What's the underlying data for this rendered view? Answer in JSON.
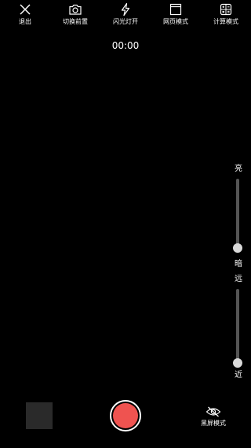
{
  "toolbar": {
    "exit": {
      "label": "退出",
      "icon": "close-icon"
    },
    "switch_camera": {
      "label": "切换前置",
      "icon": "camera-switch-icon"
    },
    "flash": {
      "label": "闪光灯开",
      "icon": "flash-icon"
    },
    "web_mode": {
      "label": "网页模式",
      "icon": "browser-window-icon"
    },
    "calc_mode": {
      "label": "计算模式",
      "icon": "calculator-icon"
    }
  },
  "timer": "00:00",
  "brightness": {
    "top_label": "亮",
    "bottom_label": "暗",
    "level": 0.0
  },
  "zoom": {
    "top_label": "远",
    "bottom_label": "近",
    "level": 0.0
  },
  "bottom": {
    "black_screen": {
      "label": "黑屏模式",
      "icon": "eye-off-icon"
    },
    "record_button_icon": "record-icon"
  },
  "colors": {
    "background": "#000000",
    "record": "#ef5350",
    "slider_track": "#555555",
    "slider_thumb": "#d9d9d9"
  }
}
